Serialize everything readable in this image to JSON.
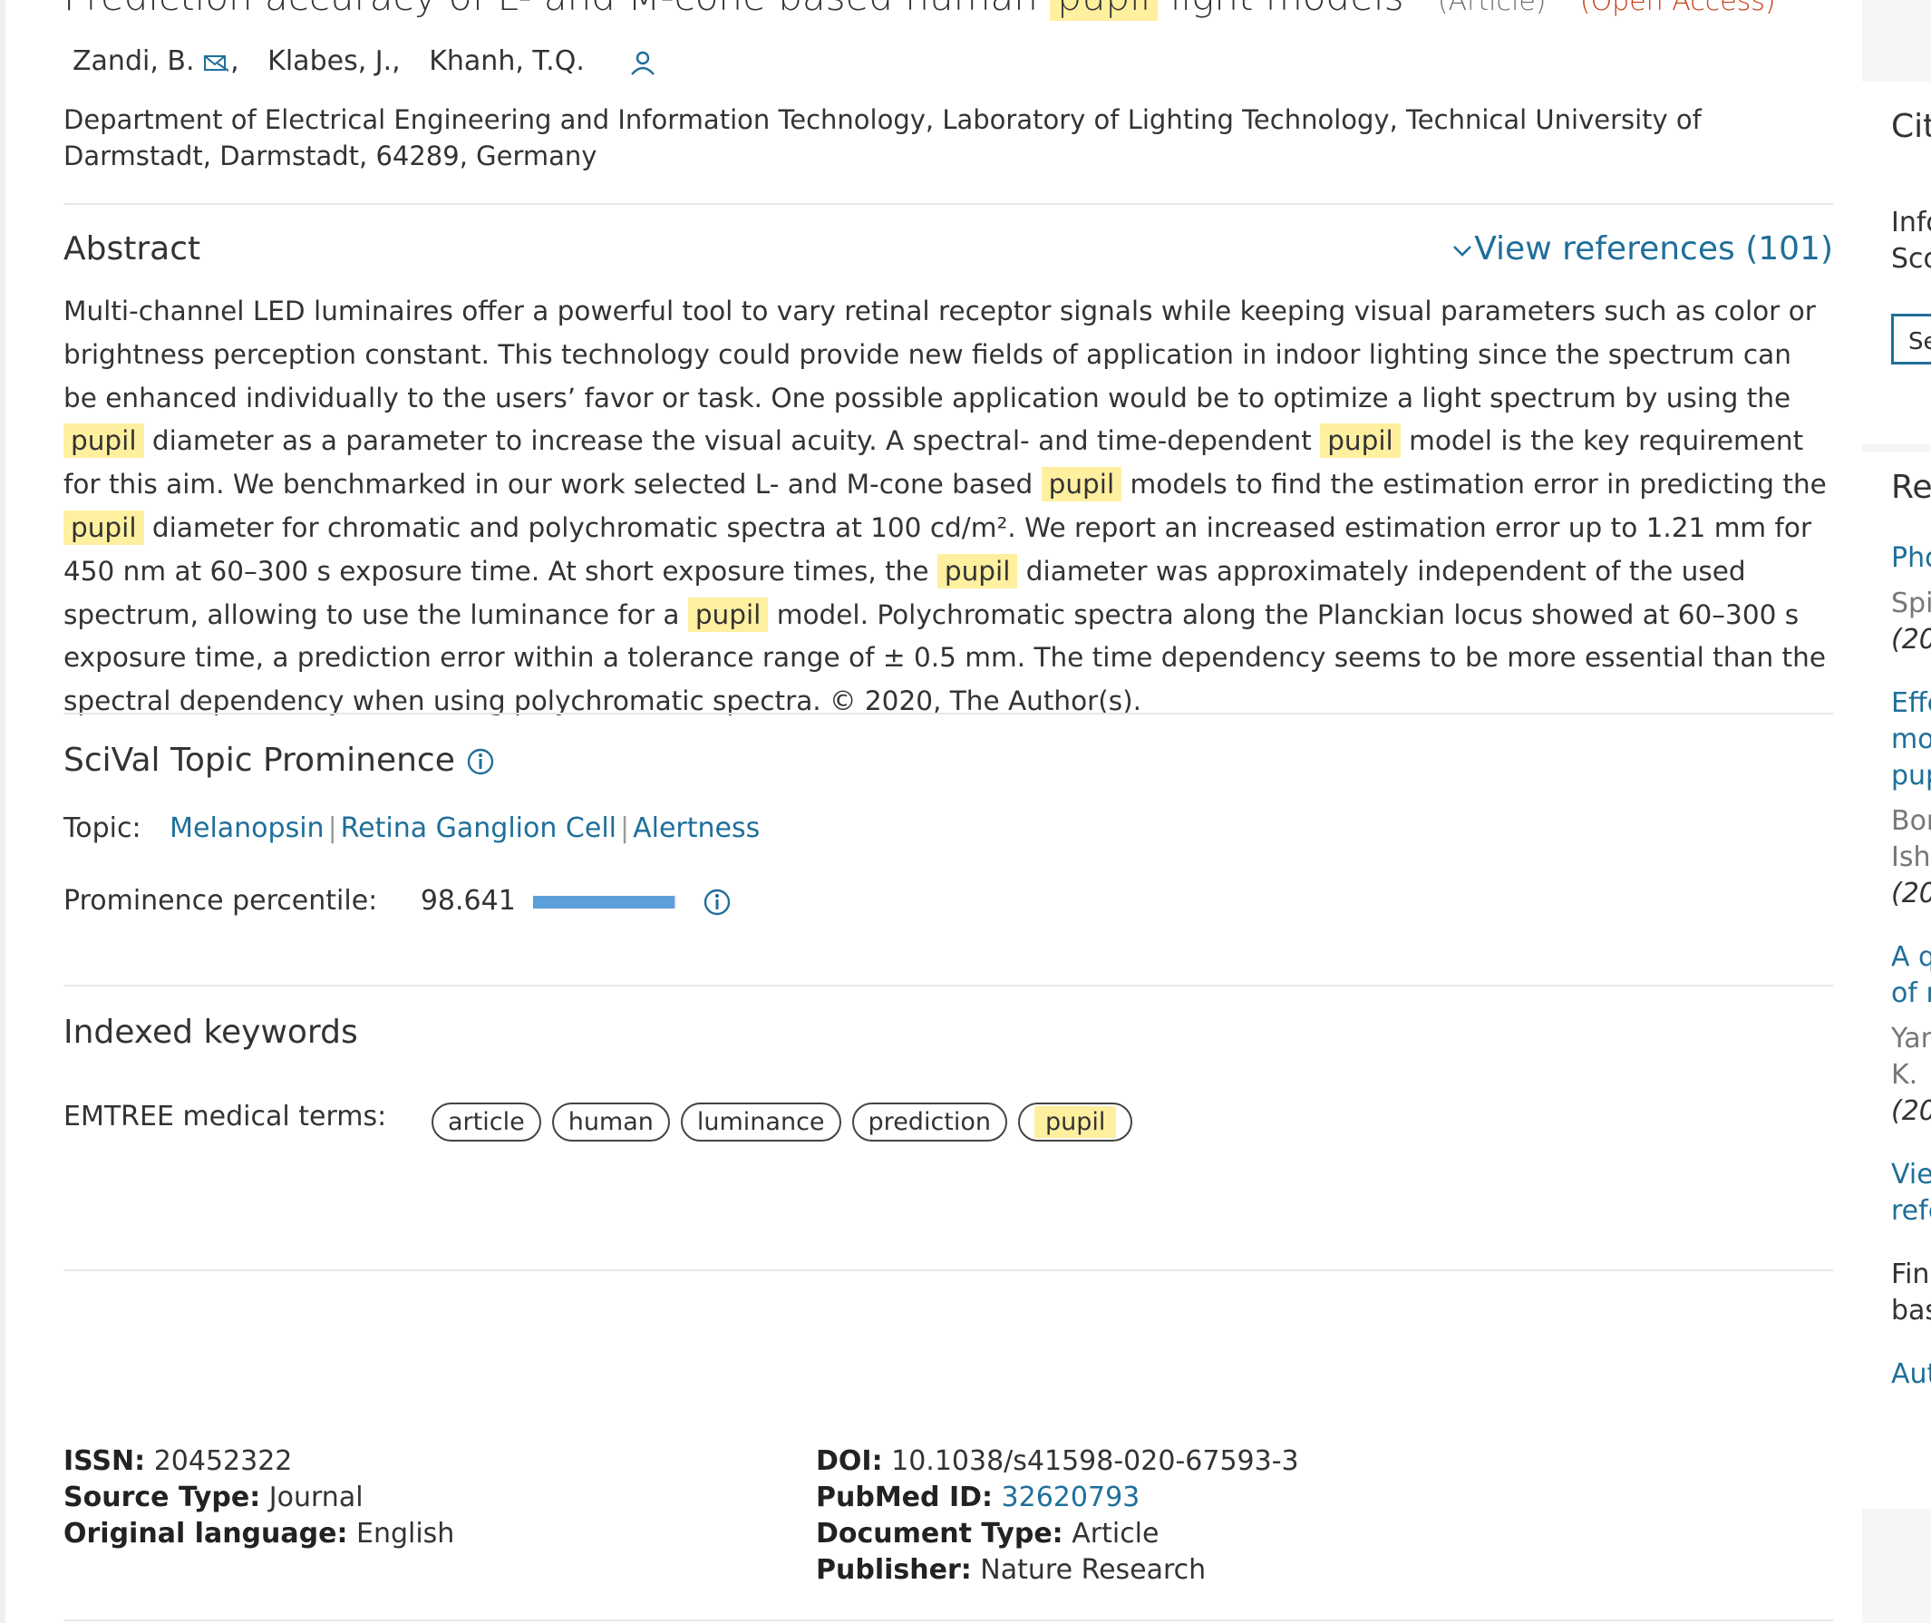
{
  "document": {
    "title_prefix": "Prediction accuracy of L- and M-cone based human",
    "title_highlight": "pupil",
    "title_suffix": "light models",
    "type_label": "(Article)",
    "open_access_label": "(Open Access)",
    "authors": [
      "Zandi, B.",
      "Klabes, J.,",
      "Khanh, T.Q."
    ],
    "affiliation": "Department of Electrical Engineering and Information Technology, Laboratory of Lighting Technology, Technical University of Darmstadt, Darmstadt, 64289, Germany"
  },
  "abstract": {
    "heading": "Abstract",
    "view_references": "View references (101)",
    "segments": [
      {
        "t": "Multi-channel LED luminaires offer a powerful tool to vary retinal receptor signals while keeping visual parameters such as color or brightness perception constant. This technology could provide new fields of application in indoor lighting since the spectrum can be enhanced individually to the users’ favor or task. One possible application would be to optimize a light spectrum by using the "
      },
      {
        "t": "pupil",
        "h": true
      },
      {
        "t": " diameter as a parameter to increase the visual acuity. A spectral- and time-dependent "
      },
      {
        "t": "pupil",
        "h": true
      },
      {
        "t": " model is the key requirement for this aim. We benchmarked in our work selected L- and M-cone based "
      },
      {
        "t": "pupil",
        "h": true
      },
      {
        "t": " models to find the estimation error in predicting the "
      },
      {
        "t": "pupil",
        "h": true
      },
      {
        "t": " diameter for chromatic and polychromatic spectra at 100 cd/m². We report an increased estimation error up to 1.21 mm for 450 nm at 60–300 s exposure time. At short exposure times, the "
      },
      {
        "t": "pupil",
        "h": true
      },
      {
        "t": " diameter was approximately independent of the used spectrum, allowing to use the luminance for a "
      },
      {
        "t": "pupil",
        "h": true
      },
      {
        "t": " model. Polychromatic spectra along the Planckian locus showed at 60–300 s exposure time, a prediction error within a tolerance range of ± 0.5 mm. The time dependency seems to be more essential than the spectral dependency when using polychromatic spectra. © 2020, The Author(s)."
      }
    ]
  },
  "scival": {
    "heading": "SciVal Topic Prominence",
    "topic_label": "Topic:",
    "topics": [
      "Melanopsin",
      "Retina Ganglion Cell",
      "Alertness"
    ],
    "prominence_label": "Prominence percentile:",
    "prominence_value": "98.641",
    "prominence_fraction": 0.98641
  },
  "keywords": {
    "heading": "Indexed keywords",
    "emtree_label": "EMTREE medical terms:",
    "terms": [
      {
        "t": "article"
      },
      {
        "t": "human"
      },
      {
        "t": "luminance"
      },
      {
        "t": "prediction"
      },
      {
        "t": "pupil",
        "h": true
      }
    ]
  },
  "metadata": {
    "left": [
      {
        "label": "ISSN:",
        "value": "20452322"
      },
      {
        "label": "Source Type:",
        "value": "Journal"
      },
      {
        "label": "Original language:",
        "value": "English"
      }
    ],
    "right": [
      {
        "label": "DOI:",
        "value": "10.1038/s41598-020-67593-3"
      },
      {
        "label": "PubMed ID:",
        "value": "32620793",
        "link": true
      },
      {
        "label": "Document Type:",
        "value": "Article"
      },
      {
        "label": "Publisher:",
        "value": "Nature Research"
      }
    ]
  },
  "sidebar": {
    "cit_heading": "Cit",
    "info_lines": [
      "Info",
      "Sco"
    ],
    "button_label": "Se",
    "rel_heading": "Re",
    "items": [
      {
        "link": [
          "Pho"
        ],
        "authors": [
          "Spi"
        ],
        "year": "(20"
      },
      {
        "link": [
          "Effe",
          "mo",
          "pup"
        ],
        "authors": [
          "Bor",
          "Ishe"
        ],
        "year": "(20"
      },
      {
        "link": [
          "A q",
          "of r"
        ],
        "authors": [
          "Yan",
          "K."
        ],
        "year": "(20"
      }
    ],
    "view_more": [
      "Viev",
      "refe"
    ],
    "find_text": [
      "Fine",
      "bas"
    ],
    "aut_link": "Aut"
  },
  "colors": {
    "link": "#1f6f9a",
    "highlight": "#fff0a0",
    "open_access": "#c83e14",
    "bar": "#5b9fdb"
  }
}
